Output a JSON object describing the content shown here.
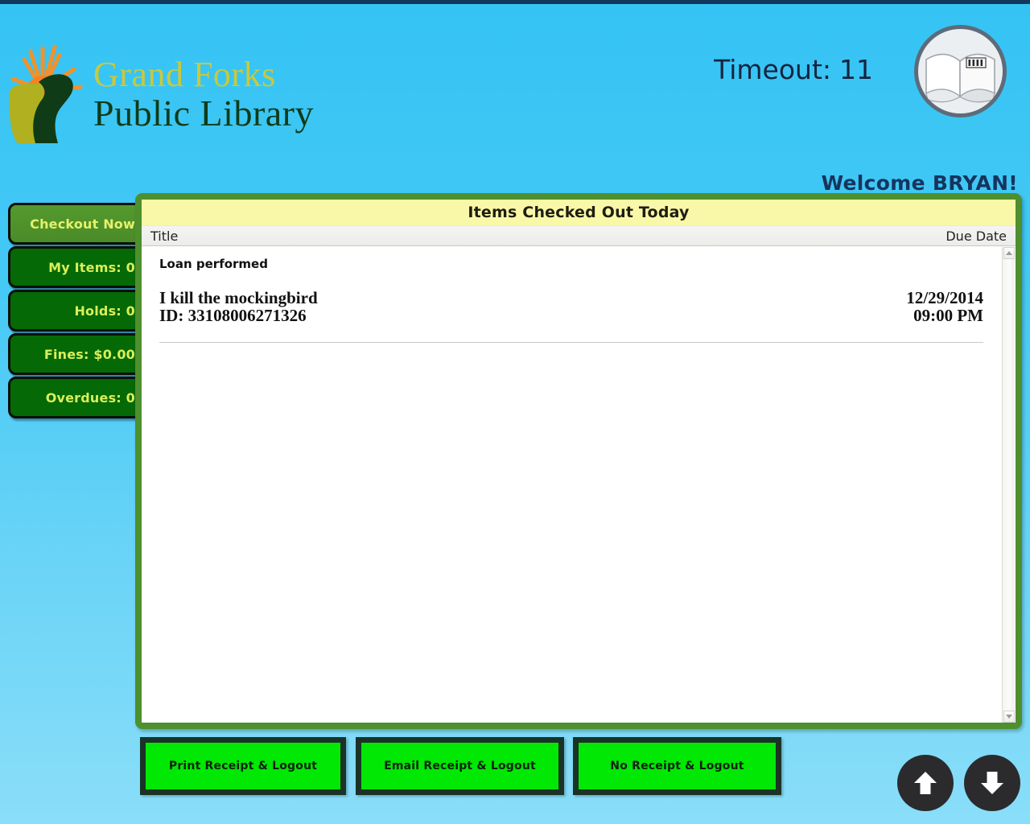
{
  "branding": {
    "line1": "Grand Forks",
    "line2": "Public Library",
    "logo_icon": "library-sunburst-logo",
    "badge_icon": "open-book-icon",
    "colors": {
      "line1": "#c9c93b",
      "line2": "#0f3b17",
      "background_top": "#34c3f4",
      "background_bottom": "#8adef9",
      "panel_border": "#4e8f2e",
      "panel_title_bg": "#f8f8a8",
      "sidebar_button": "#056905",
      "sidebar_button_active": "#4a8b28",
      "sidebar_text": "#d9ef5a",
      "footer_button": "#00e803",
      "footer_button_border": "#1a3326",
      "timeout_text": "#16243f"
    }
  },
  "header": {
    "timeout_label": "Timeout:",
    "timeout_value": "11",
    "welcome": "Welcome BRYAN!"
  },
  "sidebar": {
    "items": [
      {
        "label": "Checkout Now",
        "active": true
      },
      {
        "label": "My Items: 0",
        "active": false
      },
      {
        "label": "Holds: 0",
        "active": false
      },
      {
        "label": "Fines: $0.00",
        "active": false
      },
      {
        "label": "Overdues: 0",
        "active": false
      }
    ]
  },
  "panel": {
    "title": "Items Checked Out Today",
    "columns": {
      "title": "Title",
      "due_date": "Due Date"
    },
    "status_message": "Loan performed",
    "rows": [
      {
        "title": "I kill the mockingbird",
        "id_label": "ID: 33108006271326",
        "due_date": "12/29/2014",
        "due_time": "09:00 PM"
      }
    ]
  },
  "footer": {
    "buttons": [
      {
        "label": "Print Receipt & Logout"
      },
      {
        "label": "Email Receipt & Logout"
      },
      {
        "label": "No Receipt & Logout"
      }
    ],
    "scroll_up_icon": "arrow-up-icon",
    "scroll_down_icon": "arrow-down-icon"
  }
}
